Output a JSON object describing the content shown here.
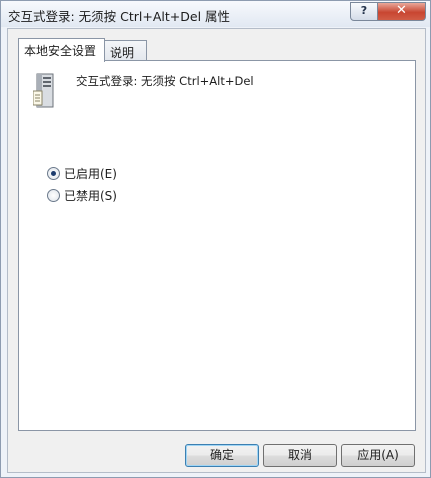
{
  "window": {
    "title": "交互式登录: 无须按 Ctrl+Alt+Del 属性",
    "help_button": "?",
    "close_button": "✕"
  },
  "tabs": [
    {
      "label": "本地安全设置",
      "active": true
    },
    {
      "label": "说明",
      "active": false
    }
  ],
  "policy": {
    "icon": "server-computer-icon",
    "name": "交互式登录: 无须按 Ctrl+Alt+Del"
  },
  "options": [
    {
      "label": "已启用(E)",
      "selected": true
    },
    {
      "label": "已禁用(S)",
      "selected": false
    }
  ],
  "buttons": {
    "ok": "确定",
    "cancel": "取消",
    "apply": "应用(A)"
  },
  "colors": {
    "close_red": "#c84631",
    "accent_blue": "#3c7fb1"
  }
}
